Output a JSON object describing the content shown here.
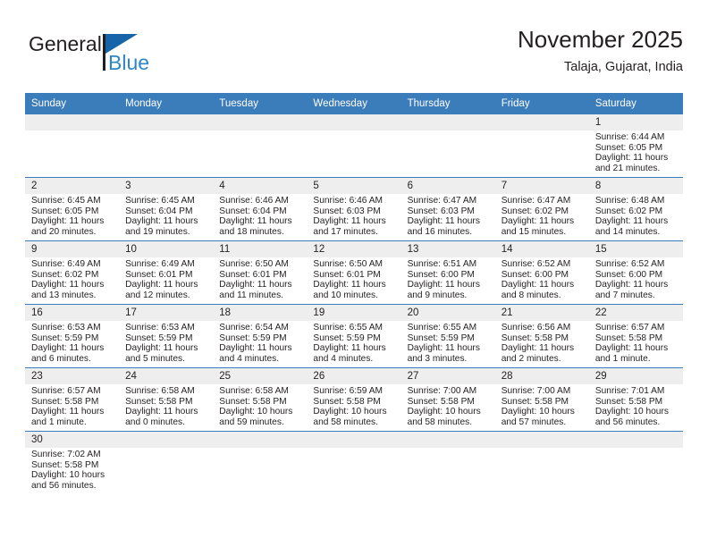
{
  "brand": {
    "word_one": "General",
    "word_two": "Blue",
    "flag_icon": "triangle-flag-icon",
    "colors": {
      "dark": "#231f20",
      "blue": "#2e86c8",
      "flag": "#1565a8"
    }
  },
  "header": {
    "title": "November 2025",
    "subtitle": "Talaja, Gujarat, India"
  },
  "theme": {
    "header_row_bg": "#3b7cba",
    "daynum_bg": "#eeeeee",
    "grid_line": "#3b7cba",
    "text": "#231f20"
  },
  "calendar": {
    "weekday_headers": [
      "Sunday",
      "Monday",
      "Tuesday",
      "Wednesday",
      "Thursday",
      "Friday",
      "Saturday"
    ],
    "weeks": [
      [
        {
          "day": "",
          "lines": []
        },
        {
          "day": "",
          "lines": []
        },
        {
          "day": "",
          "lines": []
        },
        {
          "day": "",
          "lines": []
        },
        {
          "day": "",
          "lines": []
        },
        {
          "day": "",
          "lines": []
        },
        {
          "day": "1",
          "lines": [
            "Sunrise: 6:44 AM",
            "Sunset: 6:05 PM",
            "Daylight: 11 hours",
            "and 21 minutes."
          ]
        }
      ],
      [
        {
          "day": "2",
          "lines": [
            "Sunrise: 6:45 AM",
            "Sunset: 6:05 PM",
            "Daylight: 11 hours",
            "and 20 minutes."
          ]
        },
        {
          "day": "3",
          "lines": [
            "Sunrise: 6:45 AM",
            "Sunset: 6:04 PM",
            "Daylight: 11 hours",
            "and 19 minutes."
          ]
        },
        {
          "day": "4",
          "lines": [
            "Sunrise: 6:46 AM",
            "Sunset: 6:04 PM",
            "Daylight: 11 hours",
            "and 18 minutes."
          ]
        },
        {
          "day": "5",
          "lines": [
            "Sunrise: 6:46 AM",
            "Sunset: 6:03 PM",
            "Daylight: 11 hours",
            "and 17 minutes."
          ]
        },
        {
          "day": "6",
          "lines": [
            "Sunrise: 6:47 AM",
            "Sunset: 6:03 PM",
            "Daylight: 11 hours",
            "and 16 minutes."
          ]
        },
        {
          "day": "7",
          "lines": [
            "Sunrise: 6:47 AM",
            "Sunset: 6:02 PM",
            "Daylight: 11 hours",
            "and 15 minutes."
          ]
        },
        {
          "day": "8",
          "lines": [
            "Sunrise: 6:48 AM",
            "Sunset: 6:02 PM",
            "Daylight: 11 hours",
            "and 14 minutes."
          ]
        }
      ],
      [
        {
          "day": "9",
          "lines": [
            "Sunrise: 6:49 AM",
            "Sunset: 6:02 PM",
            "Daylight: 11 hours",
            "and 13 minutes."
          ]
        },
        {
          "day": "10",
          "lines": [
            "Sunrise: 6:49 AM",
            "Sunset: 6:01 PM",
            "Daylight: 11 hours",
            "and 12 minutes."
          ]
        },
        {
          "day": "11",
          "lines": [
            "Sunrise: 6:50 AM",
            "Sunset: 6:01 PM",
            "Daylight: 11 hours",
            "and 11 minutes."
          ]
        },
        {
          "day": "12",
          "lines": [
            "Sunrise: 6:50 AM",
            "Sunset: 6:01 PM",
            "Daylight: 11 hours",
            "and 10 minutes."
          ]
        },
        {
          "day": "13",
          "lines": [
            "Sunrise: 6:51 AM",
            "Sunset: 6:00 PM",
            "Daylight: 11 hours",
            "and 9 minutes."
          ]
        },
        {
          "day": "14",
          "lines": [
            "Sunrise: 6:52 AM",
            "Sunset: 6:00 PM",
            "Daylight: 11 hours",
            "and 8 minutes."
          ]
        },
        {
          "day": "15",
          "lines": [
            "Sunrise: 6:52 AM",
            "Sunset: 6:00 PM",
            "Daylight: 11 hours",
            "and 7 minutes."
          ]
        }
      ],
      [
        {
          "day": "16",
          "lines": [
            "Sunrise: 6:53 AM",
            "Sunset: 5:59 PM",
            "Daylight: 11 hours",
            "and 6 minutes."
          ]
        },
        {
          "day": "17",
          "lines": [
            "Sunrise: 6:53 AM",
            "Sunset: 5:59 PM",
            "Daylight: 11 hours",
            "and 5 minutes."
          ]
        },
        {
          "day": "18",
          "lines": [
            "Sunrise: 6:54 AM",
            "Sunset: 5:59 PM",
            "Daylight: 11 hours",
            "and 4 minutes."
          ]
        },
        {
          "day": "19",
          "lines": [
            "Sunrise: 6:55 AM",
            "Sunset: 5:59 PM",
            "Daylight: 11 hours",
            "and 4 minutes."
          ]
        },
        {
          "day": "20",
          "lines": [
            "Sunrise: 6:55 AM",
            "Sunset: 5:59 PM",
            "Daylight: 11 hours",
            "and 3 minutes."
          ]
        },
        {
          "day": "21",
          "lines": [
            "Sunrise: 6:56 AM",
            "Sunset: 5:58 PM",
            "Daylight: 11 hours",
            "and 2 minutes."
          ]
        },
        {
          "day": "22",
          "lines": [
            "Sunrise: 6:57 AM",
            "Sunset: 5:58 PM",
            "Daylight: 11 hours",
            "and 1 minute."
          ]
        }
      ],
      [
        {
          "day": "23",
          "lines": [
            "Sunrise: 6:57 AM",
            "Sunset: 5:58 PM",
            "Daylight: 11 hours",
            "and 1 minute."
          ]
        },
        {
          "day": "24",
          "lines": [
            "Sunrise: 6:58 AM",
            "Sunset: 5:58 PM",
            "Daylight: 11 hours",
            "and 0 minutes."
          ]
        },
        {
          "day": "25",
          "lines": [
            "Sunrise: 6:58 AM",
            "Sunset: 5:58 PM",
            "Daylight: 10 hours",
            "and 59 minutes."
          ]
        },
        {
          "day": "26",
          "lines": [
            "Sunrise: 6:59 AM",
            "Sunset: 5:58 PM",
            "Daylight: 10 hours",
            "and 58 minutes."
          ]
        },
        {
          "day": "27",
          "lines": [
            "Sunrise: 7:00 AM",
            "Sunset: 5:58 PM",
            "Daylight: 10 hours",
            "and 58 minutes."
          ]
        },
        {
          "day": "28",
          "lines": [
            "Sunrise: 7:00 AM",
            "Sunset: 5:58 PM",
            "Daylight: 10 hours",
            "and 57 minutes."
          ]
        },
        {
          "day": "29",
          "lines": [
            "Sunrise: 7:01 AM",
            "Sunset: 5:58 PM",
            "Daylight: 10 hours",
            "and 56 minutes."
          ]
        }
      ],
      [
        {
          "day": "30",
          "lines": [
            "Sunrise: 7:02 AM",
            "Sunset: 5:58 PM",
            "Daylight: 10 hours",
            "and 56 minutes."
          ]
        },
        {
          "day": "",
          "lines": []
        },
        {
          "day": "",
          "lines": []
        },
        {
          "day": "",
          "lines": []
        },
        {
          "day": "",
          "lines": []
        },
        {
          "day": "",
          "lines": []
        },
        {
          "day": "",
          "lines": []
        }
      ]
    ]
  }
}
